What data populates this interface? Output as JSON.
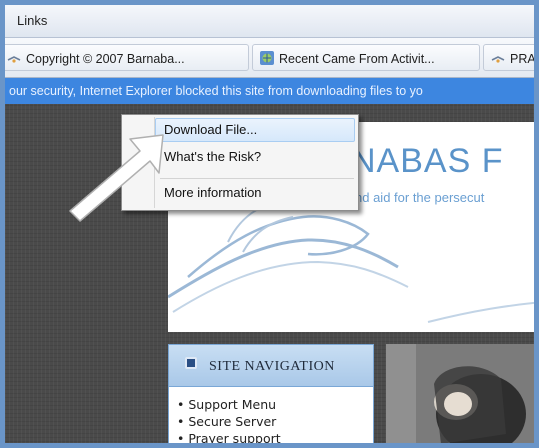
{
  "links_bar": {
    "label": "Links"
  },
  "favorites": [
    {
      "label": "Copyright © 2007 Barnaba...",
      "icon": "page-link-icon"
    },
    {
      "label": "Recent Came From Activit...",
      "icon": "globe-page-icon"
    },
    {
      "label": "PRA",
      "icon": "page-link-icon"
    }
  ],
  "info_bar": {
    "text": "our security, Internet Explorer blocked this site from downloading files to yo"
  },
  "context_menu": {
    "items": [
      {
        "label": "Download File..."
      },
      {
        "label": "What's the Risk?"
      },
      {
        "label": "More information"
      }
    ]
  },
  "page": {
    "banner_title": "NABAS F",
    "banner_subtitle": "nd aid for the persecut",
    "nav_heading": "SITE NAVIGATION",
    "nav_items": [
      "Support Menu",
      "Secure Server",
      "Prayer support"
    ]
  },
  "colors": {
    "frame": "#6a95c8",
    "info_bar": "#3d86e0",
    "arrow": "#ffffff"
  }
}
